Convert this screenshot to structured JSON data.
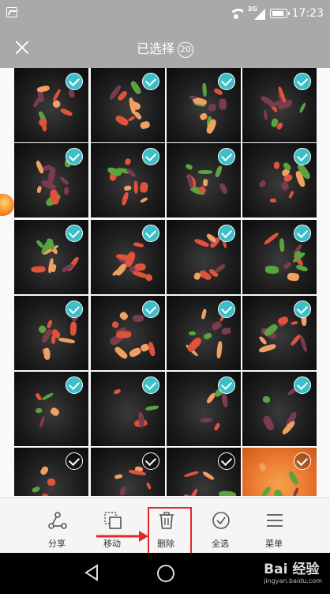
{
  "status_bar": {
    "time": "17:23",
    "network_type": "3G",
    "icons": [
      "gallery-icon",
      "wifi-icon",
      "signal-icon",
      "battery-icon"
    ]
  },
  "header": {
    "title": "已选择",
    "selected_count": "20",
    "close_icon": "close-icon"
  },
  "photos": {
    "columns": 4,
    "rows": 6,
    "selected_indices": [
      0,
      1,
      2,
      3,
      4,
      5,
      6,
      7,
      8,
      9,
      10,
      11,
      12,
      13,
      14,
      15,
      16,
      17,
      18,
      19
    ],
    "accent_color": "#3bbfc9"
  },
  "toolbar": {
    "items": [
      {
        "label": "分享",
        "icon": "share-icon"
      },
      {
        "label": "移动",
        "icon": "move-icon"
      },
      {
        "label": "删除",
        "icon": "delete-icon",
        "highlighted": true
      },
      {
        "label": "全选",
        "icon": "select-all-icon"
      },
      {
        "label": "菜单",
        "icon": "menu-icon"
      }
    ],
    "highlight_color": "#e5262a"
  },
  "nav_bar": {
    "watermark": "Bai 经验",
    "watermark_sub": "jingyan.baidu.com"
  }
}
